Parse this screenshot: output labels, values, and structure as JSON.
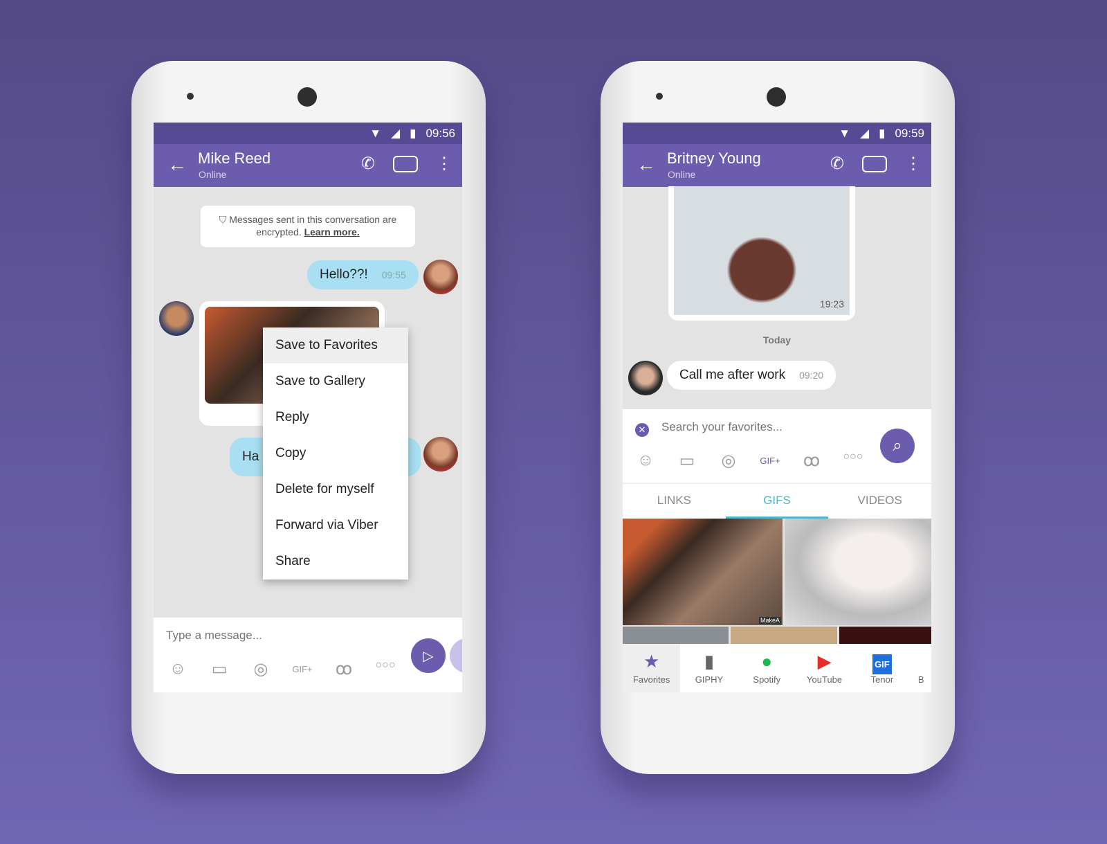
{
  "left": {
    "status": {
      "time": "09:56"
    },
    "header": {
      "name": "Mike Reed",
      "presence": "Online"
    },
    "notice": {
      "text": "Messages sent in this conversation are encrypted.",
      "link": "Learn more."
    },
    "messages": [
      {
        "text": "Hello??!",
        "time": "09:55"
      },
      {
        "text": "Ha"
      }
    ],
    "context_menu": [
      "Save to Favorites",
      "Save to Gallery",
      "Reply",
      "Copy",
      "Delete for myself",
      "Forward via Viber",
      "Share"
    ],
    "composer": {
      "placeholder": "Type a message..."
    }
  },
  "right": {
    "status": {
      "time": "09:59"
    },
    "header": {
      "name": "Britney Young",
      "presence": "Online"
    },
    "image_time": "19:23",
    "date_label": "Today",
    "message": {
      "text": "Call me after work",
      "time": "09:20"
    },
    "search": {
      "placeholder": "Search your favorites..."
    },
    "tabs": [
      "LINKS",
      "GIFS",
      "VIDEOS"
    ],
    "active_tab": "GIFS",
    "gif_watermark": "MakeA",
    "providers": [
      "Favorites",
      "GIPHY",
      "Spotify",
      "YouTube",
      "Tenor",
      "B"
    ]
  },
  "colors": {
    "header": "#6b5cad",
    "accent": "#4db6c8",
    "bubble_out": "#a8dff2"
  }
}
